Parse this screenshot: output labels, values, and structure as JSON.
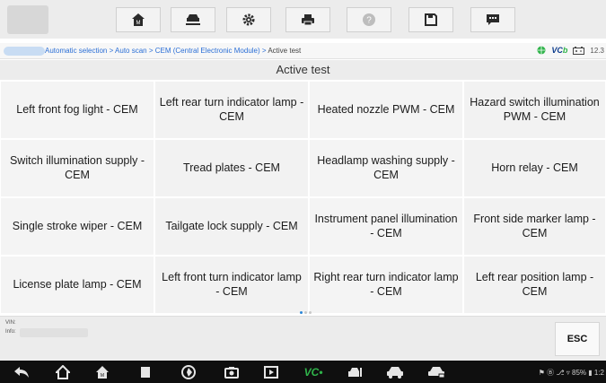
{
  "toolbar": {
    "buttons": [
      {
        "name": "home-button",
        "icon": "home-icon"
      },
      {
        "name": "vehicle-button",
        "icon": "car-lift-icon"
      },
      {
        "name": "settings-button",
        "icon": "gear-icon"
      },
      {
        "name": "print-button",
        "icon": "printer-icon"
      },
      {
        "name": "help-button",
        "icon": "help-icon"
      },
      {
        "name": "save-button",
        "icon": "save-icon"
      },
      {
        "name": "message-button",
        "icon": "chat-icon"
      }
    ]
  },
  "breadcrumb": {
    "path": "Automatic selection > Auto scan > CEM (Central Electronic Module) > ",
    "current": "Active test"
  },
  "status": {
    "vc_logo_main": "VC",
    "vc_logo_accent": "b",
    "time": "12.3"
  },
  "page": {
    "title": "Active test"
  },
  "tests": [
    "Left front fog light - CEM",
    "Left rear turn indicator lamp - CEM",
    "Heated nozzle PWM - CEM",
    "Hazard switch illumination PWM - CEM",
    "Switch illumination supply - CEM",
    "Tread plates - CEM",
    "Headlamp washing supply - CEM",
    "Horn relay - CEM",
    "Single stroke wiper - CEM",
    "Tailgate lock supply - CEM",
    "Instrument panel illumination - CEM",
    "Front side marker lamp - CEM",
    "License plate lamp - CEM",
    "Left front turn indicator lamp - CEM",
    "Right rear turn indicator lamp - CEM",
    "Left rear position lamp - CEM"
  ],
  "footer": {
    "vin_label": "VIN:",
    "info_label": "Info: ",
    "esc_label": "ESC"
  },
  "navbar": {
    "vc_main": "VC",
    "vc_accent": "•",
    "system_status": "⚑ Ⓑ ⎇ ▿ 85% ▮ 1:2"
  },
  "colors": {
    "accent_blue": "#2b6fd6",
    "vc_green": "#2fb34a",
    "nav_bg": "#0f0f0f"
  }
}
